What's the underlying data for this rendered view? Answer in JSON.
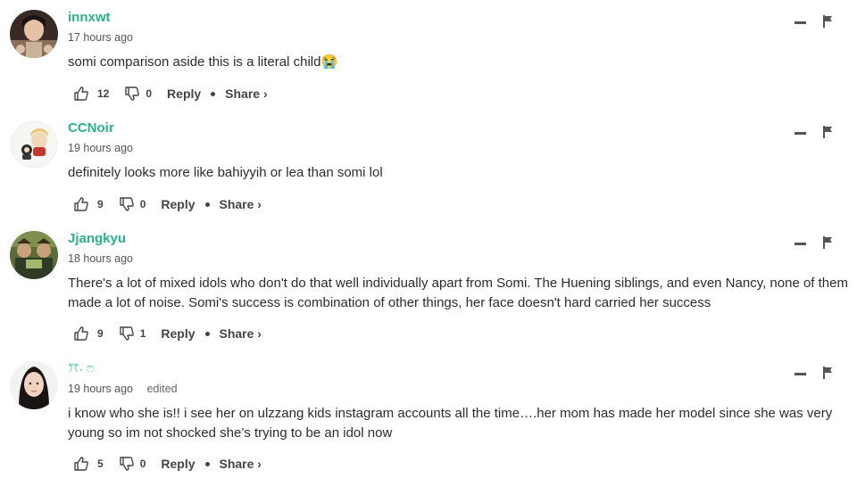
{
  "comments": [
    {
      "username": "innxwt",
      "time": "17 hours ago",
      "edited": "",
      "text": "somi comparison aside this is a literal child😭",
      "likes": "12",
      "dislikes": "0",
      "reply_label": "Reply",
      "share_label": "Share ›"
    },
    {
      "username": "CCNoir",
      "time": "19 hours ago",
      "edited": "",
      "text": "definitely looks more like bahiyyih or lea than somi lol",
      "likes": "9",
      "dislikes": "0",
      "reply_label": "Reply",
      "share_label": "Share ›"
    },
    {
      "username": "Jjangkyu",
      "time": "18 hours ago",
      "edited": "",
      "text": "There's a lot of mixed idols who don't do that well individually apart from Somi. The Huening siblings, and even Nancy, none of them made a lot of noise. Somi's success is combination of other things, her face doesn't hard carried her success",
      "likes": "9",
      "dislikes": "1",
      "reply_label": "Reply",
      "share_label": "Share ›"
    },
    {
      "username": "ꔫ˖ ෆ",
      "time": "19 hours ago",
      "edited": "edited",
      "text": "i know who she is!! i see her on ulzzang kids instagram accounts all the time….her mom has made her model since she was very young so im not shocked she’s trying to be an idol now",
      "likes": "5",
      "dislikes": "0",
      "reply_label": "Reply",
      "share_label": "Share ›"
    }
  ],
  "icons": {
    "like": "thumbs-up-icon",
    "dislike": "thumbs-down-icon",
    "minimize": "minimize-icon",
    "flag": "flag-icon"
  },
  "colors": {
    "username": "#2ab38a",
    "text": "#2b2b2b",
    "meta": "#555555"
  }
}
